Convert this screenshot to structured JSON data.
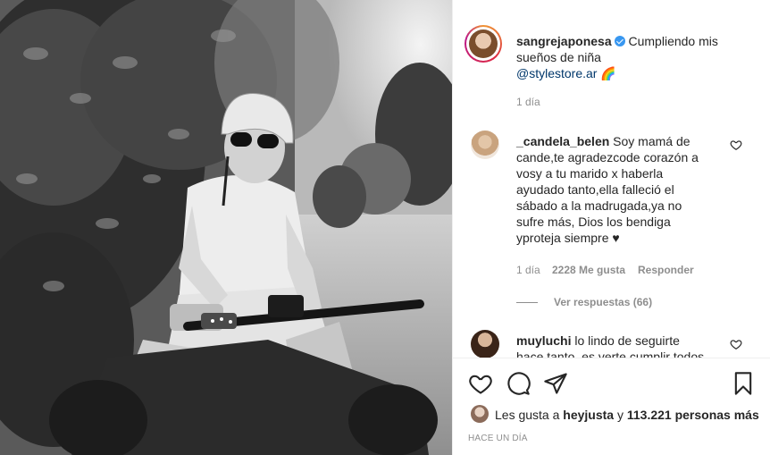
{
  "post": {
    "author": "sangrejaponesa",
    "caption_text": "Cumpliendo mis sueños de niña",
    "caption_mention": "@stylestore.ar",
    "caption_emoji": "🌈",
    "caption_time": "1 día",
    "photo_alt": "Black and white photo of a woman in a helmet and sunglasses on a quad bike"
  },
  "comments": [
    {
      "user": "_candela_belen",
      "text": "Soy mamá de cande,te agradezcode corazón a vosy a tu marido x haberla ayudado tanto,ella falleció el sábado a la madrugada,ya no sufre más, Dios los bendiga yproteja siempre ♥",
      "lines": [
        "Soy mamá de",
        "cande,te agradezcode corazón a",
        "vosy a tu marido x haberla",
        "ayudado tanto,ella falleció el",
        "sábado a la madrugada,ya no",
        "sufre más, Dios los bendiga",
        "yproteja siempre ♥"
      ],
      "time": "1 día",
      "likes": "2228 Me gusta",
      "reply": "Responder",
      "view_replies": "Ver respuestas (66)"
    },
    {
      "user": "muyluchi",
      "text": "lo lindo de seguirte",
      "second_line": "hace tanto, es verte cumplir todos"
    }
  ],
  "likes_summary": {
    "prefix": "Les gusta a",
    "user": "heyjusta",
    "middle": "y",
    "count": "113.221 personas más"
  },
  "timestamp": "HACE UN DÍA",
  "icons": {
    "like": "heart-icon",
    "comment": "comment-icon",
    "share": "paper-plane-icon",
    "save": "bookmark-icon"
  }
}
